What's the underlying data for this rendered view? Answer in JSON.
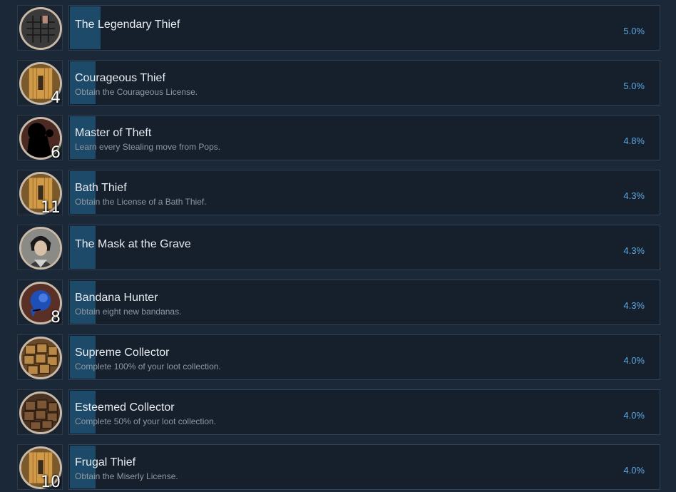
{
  "achievements": [
    {
      "title": "The Legendary Thief",
      "description": "",
      "percent": "5.0%",
      "icon": "shogi-board-icon",
      "badge_number": "",
      "fill": 0.05
    },
    {
      "title": "Courageous Thief",
      "description": "Obtain the Courageous License.",
      "percent": "5.0%",
      "icon": "license-scroll-icon",
      "badge_number": "4",
      "fill": 0.05
    },
    {
      "title": "Master of Theft",
      "description": "Learn every Stealing move from Pops.",
      "percent": "4.8%",
      "icon": "silhouette-icon",
      "badge_number": "6",
      "fill": 0.048
    },
    {
      "title": "Bath Thief",
      "description": "Obtain the License of a Bath Thief.",
      "percent": "4.3%",
      "icon": "license-scroll-icon",
      "badge_number": "11",
      "fill": 0.043
    },
    {
      "title": "The Mask at the Grave",
      "description": "",
      "percent": "4.3%",
      "icon": "character-portrait-icon",
      "badge_number": "",
      "fill": 0.043
    },
    {
      "title": "Bandana Hunter",
      "description": "Obtain eight new bandanas.",
      "percent": "4.3%",
      "icon": "blue-bandana-icon",
      "badge_number": "8",
      "fill": 0.043
    },
    {
      "title": "Supreme Collector",
      "description": "Complete 100% of your loot collection.",
      "percent": "4.0%",
      "icon": "loot-crates-icon",
      "badge_number": "",
      "fill": 0.04
    },
    {
      "title": "Esteemed Collector",
      "description": "Complete 50% of your loot collection.",
      "percent": "4.0%",
      "icon": "loot-crates-icon",
      "badge_number": "",
      "fill": 0.04
    },
    {
      "title": "Frugal Thief",
      "description": "Obtain the Miserly License.",
      "percent": "4.0%",
      "icon": "license-scroll-icon",
      "badge_number": "10",
      "fill": 0.04
    }
  ]
}
